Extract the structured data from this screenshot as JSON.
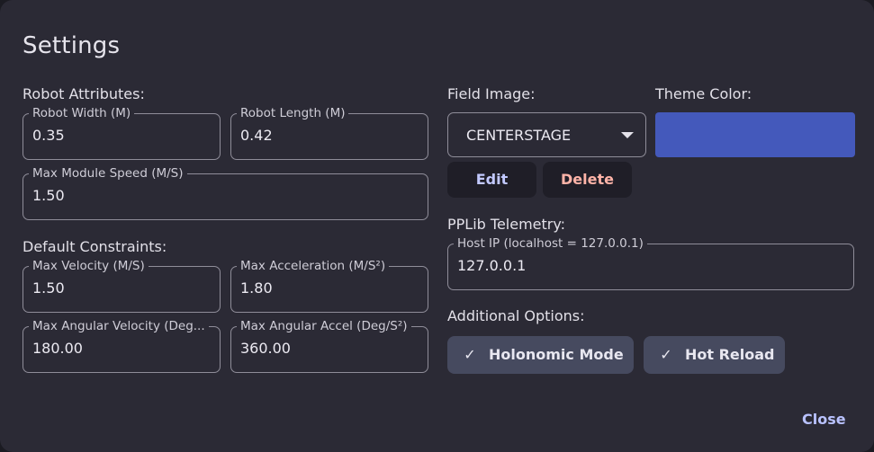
{
  "dialog": {
    "title": "Settings",
    "close_label": "Close"
  },
  "robot_attributes": {
    "label": "Robot Attributes:",
    "width": {
      "label": "Robot Width (M)",
      "value": "0.35"
    },
    "length": {
      "label": "Robot Length (M)",
      "value": "0.42"
    },
    "max_module_speed": {
      "label": "Max Module Speed (M/S)",
      "value": "1.50"
    }
  },
  "default_constraints": {
    "label": "Default Constraints:",
    "max_velocity": {
      "label": "Max Velocity (M/S)",
      "value": "1.50"
    },
    "max_acceleration": {
      "label": "Max Acceleration (M/S²)",
      "value": "1.80"
    },
    "max_angular_velocity": {
      "label": "Max Angular Velocity (Deg...",
      "value": "180.00"
    },
    "max_angular_accel": {
      "label": "Max Angular Accel (Deg/S²)",
      "value": "360.00"
    }
  },
  "field_image": {
    "label": "Field Image:",
    "selected": "CENTERSTAGE",
    "edit_label": "Edit",
    "delete_label": "Delete"
  },
  "theme_color": {
    "label": "Theme Color:",
    "color": "#4459bb"
  },
  "telemetry": {
    "label": "PPLib Telemetry:",
    "host_ip": {
      "label": "Host IP (localhost = 127.0.0.1)",
      "value": "127.0.0.1"
    }
  },
  "additional_options": {
    "label": "Additional Options:",
    "holonomic": {
      "label": "Holonomic Mode",
      "checked": true,
      "icon": "check-icon"
    },
    "hot_reload": {
      "label": "Hot Reload",
      "checked": true,
      "icon": "check-icon"
    }
  },
  "colors": {
    "dialog_bg": "#2b2a35",
    "accent": "#b9c2ff",
    "edit_text": "#c2c9ff",
    "delete_text": "#ffb4a8",
    "chip_bg": "#464a5f"
  }
}
